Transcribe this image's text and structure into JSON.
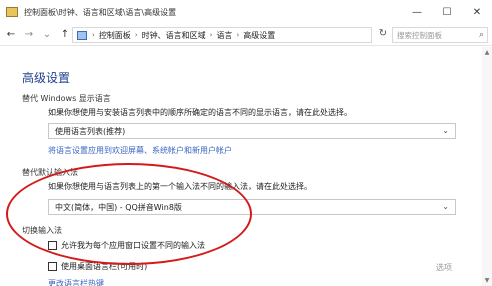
{
  "window": {
    "title": "控制面板\\时钟、语言和区域\\语言\\高级设置",
    "minimize": "—",
    "maximize": "☐",
    "close": "✕"
  },
  "nav": {
    "back": "←",
    "forward": "→",
    "dropdown": "⌄",
    "up": "↑",
    "breadcrumbs": [
      "控制面板",
      "时钟、语言和区域",
      "语言",
      "高级设置"
    ],
    "breadcrumb_sep": "›",
    "refresh": "↻",
    "search_placeholder": "搜索控制面板",
    "search_icon": "⌕"
  },
  "page": {
    "title": "高级设置",
    "sections": {
      "display_language": {
        "title": "替代 Windows 显示语言",
        "description": "如果你想使用与安装语言列表中的顺序所确定的语言不同的显示语言，请在此处选择。",
        "select_value": "使用语言列表(推荐)",
        "link": "将语言设置应用到欢迎屏幕、系统帐户和新用户帐户"
      },
      "input_method": {
        "title": "替代默认输入法",
        "description": "如果你想使用与语言列表上的第一个输入法不同的输入法，请在此处选择。",
        "select_value": "中文(简体，中国) - QQ拼音Win8版"
      },
      "switch_input": {
        "title": "切换输入法",
        "checkbox1": "允许我为每个应用窗口设置不同的输入法",
        "checkbox2": "使用桌面语言栏(可用时)",
        "options": "选项",
        "link": "更改语言栏热键"
      }
    }
  },
  "chevron": "⌄",
  "accent_colors": {
    "title_blue": "#1e3f8f",
    "link_blue": "#3a65c4",
    "annotation_red": "#d41b1b"
  }
}
